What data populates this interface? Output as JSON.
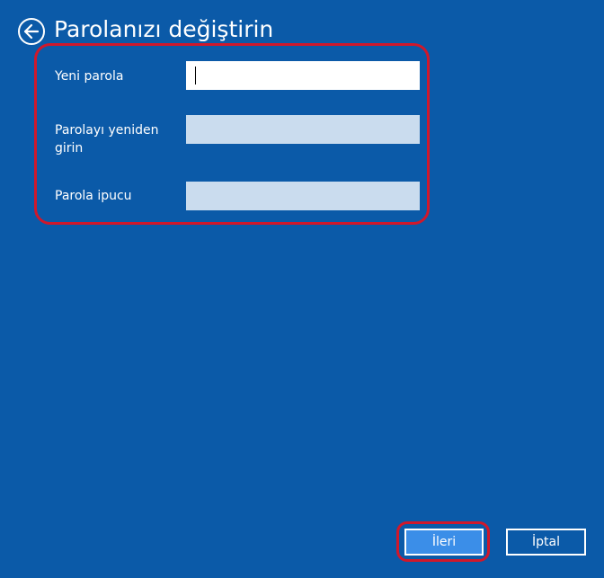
{
  "header": {
    "title": "Parolanızı değiştirin",
    "back_icon": "back-arrow-icon"
  },
  "form": {
    "new_password": {
      "label": "Yeni parola",
      "value": ""
    },
    "reenter_password": {
      "label": "Parolayı yeniden girin",
      "value": ""
    },
    "password_hint": {
      "label": "Parola ipucu",
      "value": ""
    }
  },
  "footer": {
    "next_label": "İleri",
    "cancel_label": "İptal"
  },
  "colors": {
    "background": "#0b5aa8",
    "highlight": "#d0182b",
    "next_button": "#3b8ee8",
    "input_disabled": "#cadcee"
  }
}
